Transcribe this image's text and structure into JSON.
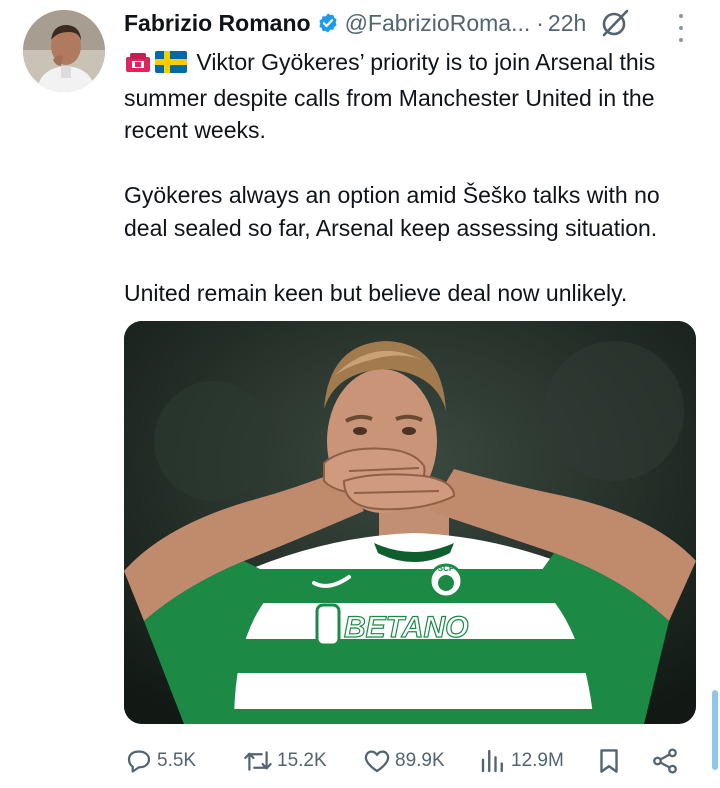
{
  "author": {
    "name": "Fabrizio Romano",
    "handle": "@FabrizioRoma...",
    "separator": "·",
    "time": "22h"
  },
  "tweet": {
    "paragraphs": [
      "Viktor Gyökeres’ priority is to join Arsenal this summer despite calls from Manchester United in the recent weeks.",
      "Gyökeres always an option amid Šeško talks with no deal sealed so far, Arsenal keep assessing situation.",
      "United remain keen but believe deal now unlikely."
    ],
    "leading_emojis": [
      "police-light-emoji",
      "sweden-flag-emoji"
    ],
    "media": {
      "jersey_sponsor": "BETANO",
      "crest": "SCP"
    }
  },
  "actions": {
    "replies": "5.5K",
    "reposts": "15.2K",
    "likes": "89.9K",
    "views": "12.9M"
  },
  "colors": {
    "text": "#0f1419",
    "secondary": "#536471",
    "verified": "#1d9bf0",
    "jersey_green": "#1c8a45"
  }
}
